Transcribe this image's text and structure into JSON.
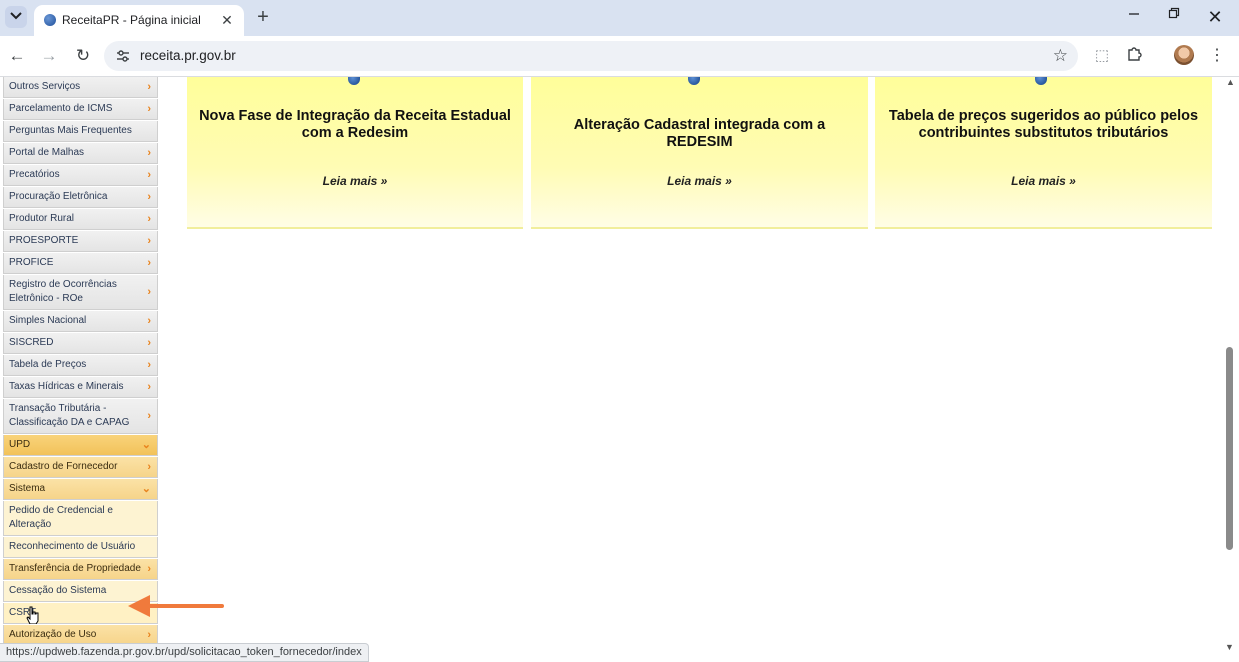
{
  "browser": {
    "tab_title": "ReceitaPR - Página inicial",
    "url": "receita.pr.gov.br",
    "status_url": "https://updweb.fazenda.pr.gov.br/upd/solicitacao_token_fornecedor/index"
  },
  "sidebar": {
    "items": [
      {
        "label": "Outros Serviços",
        "arrow": "›"
      },
      {
        "label": "Parcelamento de ICMS",
        "arrow": "›"
      },
      {
        "label": "Perguntas Mais Frequentes",
        "arrow": ""
      },
      {
        "label": "Portal de Malhas",
        "arrow": "›"
      },
      {
        "label": "Precatórios",
        "arrow": "›"
      },
      {
        "label": "Procuração Eletrônica",
        "arrow": "›"
      },
      {
        "label": "Produtor Rural",
        "arrow": "›"
      },
      {
        "label": "PROESPORTE",
        "arrow": "›"
      },
      {
        "label": "PROFICE",
        "arrow": "›"
      },
      {
        "label": "Registro de Ocorrências Eletrônico - ROe",
        "arrow": "›"
      },
      {
        "label": "Simples Nacional",
        "arrow": "›"
      },
      {
        "label": "SISCRED",
        "arrow": "›"
      },
      {
        "label": "Tabela de Preços",
        "arrow": "›"
      },
      {
        "label": "Taxas Hídricas e Minerais",
        "arrow": "›"
      },
      {
        "label": "Transação Tributária - Classificação DA e CAPAG",
        "arrow": "›"
      },
      {
        "label": "UPD",
        "arrow": "⌄"
      },
      {
        "label": "Cadastro de Fornecedor",
        "arrow": "›"
      },
      {
        "label": "Sistema",
        "arrow": "⌄"
      },
      {
        "label": "Pedido de Credencial e Alteração",
        "arrow": ""
      },
      {
        "label": "Reconhecimento de Usuário",
        "arrow": ""
      },
      {
        "label": "Transferência de Propriedade",
        "arrow": "›"
      },
      {
        "label": "Cessação do Sistema",
        "arrow": ""
      },
      {
        "label": "CSRT",
        "arrow": ""
      },
      {
        "label": "Autorização de Uso",
        "arrow": "›"
      }
    ]
  },
  "news": [
    {
      "title": "Nova Fase de Integração da Receita Estadual com a Redesim",
      "more": "Leia mais »"
    },
    {
      "title": "Alteração Cadastral integrada com a REDESIM",
      "more": "Leia mais »"
    },
    {
      "title": "Tabela de preços sugeridos ao público pelos contribuintes substitutos tributários",
      "more": "Leia mais »"
    }
  ],
  "colors": {
    "annotation_arrow": "#f07a3c",
    "card_yellow": "#fffe9a",
    "menu_arrow": "#e8831e"
  }
}
